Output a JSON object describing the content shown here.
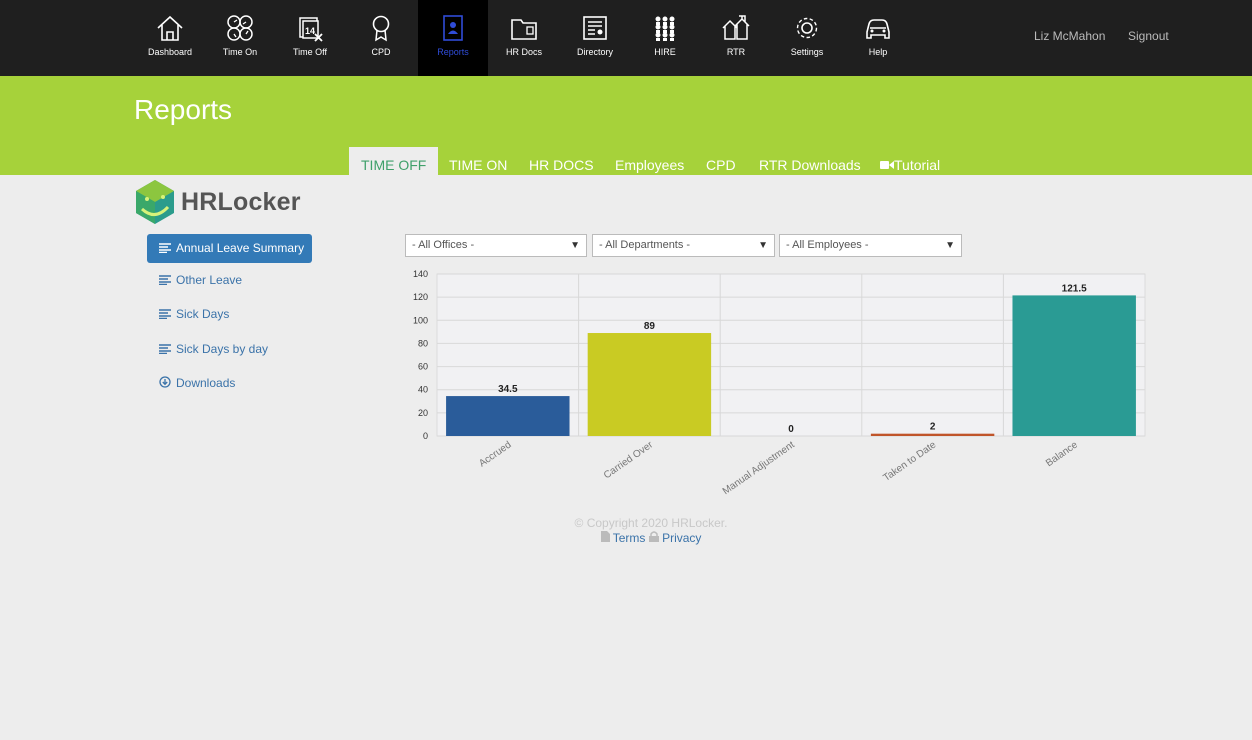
{
  "nav": {
    "items": [
      {
        "label": "Dashboard",
        "icon": "home-icon"
      },
      {
        "label": "Time On",
        "icon": "time-on-icon"
      },
      {
        "label": "Time Off",
        "icon": "calendar-icon"
      },
      {
        "label": "CPD",
        "icon": "ribbon-award-icon"
      },
      {
        "label": "Reports",
        "icon": "reports-icon"
      },
      {
        "label": "HR Docs",
        "icon": "folder-icon"
      },
      {
        "label": "Directory",
        "icon": "directory-icon"
      },
      {
        "label": "HIRE",
        "icon": "people-grid-icon"
      },
      {
        "label": "RTR",
        "icon": "houses-icon"
      },
      {
        "label": "Settings",
        "icon": "gear-icon"
      },
      {
        "label": "Help",
        "icon": "car-icon"
      }
    ],
    "active": "Reports",
    "user_name": "Liz McMahon",
    "signout_label": "Signout"
  },
  "header": {
    "title": "Reports",
    "tabs": [
      "TIME OFF",
      "TIME ON",
      "HR DOCS",
      "Employees",
      "CPD",
      "RTR Downloads",
      "Tutorial"
    ],
    "active_tab": "TIME OFF",
    "bg_color": "#a6d23a"
  },
  "logo": {
    "text": "HRLocker"
  },
  "sidebar": {
    "items": [
      {
        "label": "Annual Leave Summary",
        "icon": "list-icon",
        "active": true
      },
      {
        "label": "Other Leave",
        "icon": "list-icon"
      },
      {
        "label": "Sick Days",
        "icon": "list-icon"
      },
      {
        "label": "Sick Days by day",
        "icon": "list-icon"
      },
      {
        "label": "Downloads",
        "icon": "download-circle-icon"
      }
    ]
  },
  "filters": {
    "offices": "- All Offices -",
    "departments": "- All Departments -",
    "employees": "- All Employees -"
  },
  "chart_data": {
    "type": "bar",
    "categories": [
      "Accrued",
      "Carried Over",
      "Manual Adjustment",
      "Taken to Date",
      "Balance"
    ],
    "values": [
      34.5,
      89,
      0,
      2,
      121.5
    ],
    "data_labels": [
      "34.5",
      "89",
      "0",
      "2",
      "121.5"
    ],
    "colors": [
      "#2a5c9a",
      "#c9cb23",
      "#888888",
      "#c0552a",
      "#2a9b94"
    ],
    "ylim": [
      0,
      140
    ],
    "yticks": [
      0,
      20,
      40,
      60,
      80,
      100,
      120,
      140
    ],
    "grid": true
  },
  "footer": {
    "copyright": "© Copyright 2020 HRLocker.",
    "terms": "Terms",
    "privacy": "Privacy"
  }
}
